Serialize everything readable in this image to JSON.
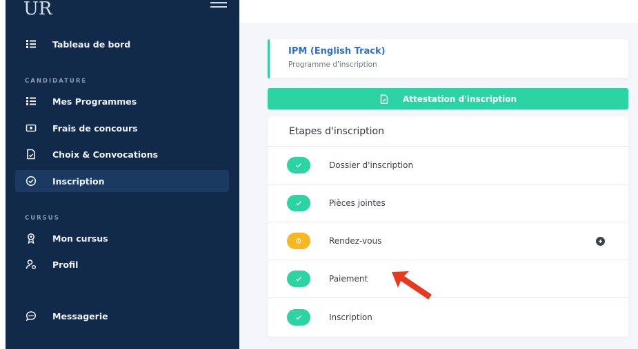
{
  "sidebar": {
    "logo": "UR",
    "items": [
      {
        "label": "Tableau de bord"
      },
      {
        "label": "Mes Programmes"
      },
      {
        "label": "Frais de concours"
      },
      {
        "label": "Choix & Convocations"
      },
      {
        "label": "Inscription"
      },
      {
        "label": "Mon cursus"
      },
      {
        "label": "Profil"
      },
      {
        "label": "Messagerie"
      }
    ],
    "sections": [
      "CANDIDATURE",
      "CURSUS"
    ]
  },
  "program": {
    "title": "IPM (English Track)",
    "subtitle": "Programme d'inscription"
  },
  "attestation_button": "Attestation d'inscription",
  "steps": {
    "title": "Etapes d'inscription",
    "items": [
      {
        "label": "Dossier d'inscription",
        "status": "done"
      },
      {
        "label": "Pièces jointes",
        "status": "done"
      },
      {
        "label": "Rendez-vous",
        "status": "pending"
      },
      {
        "label": "Paiement",
        "status": "done"
      },
      {
        "label": "Inscription",
        "status": "done"
      }
    ]
  },
  "colors": {
    "sidebar_bg": "#112a4a",
    "accent_green": "#2dd4a3",
    "pending_yellow": "#f5b824",
    "link_blue": "#2b6fd0",
    "arrow_red": "#e8381e"
  }
}
